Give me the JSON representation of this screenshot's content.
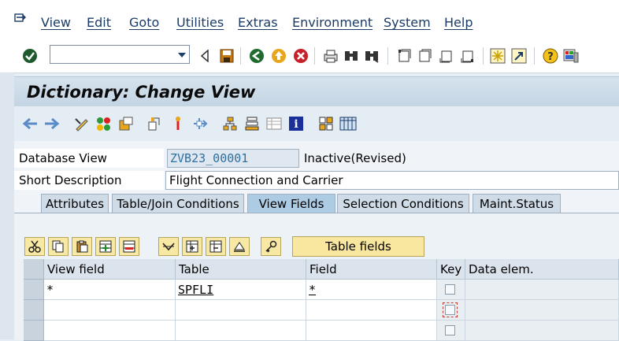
{
  "menu": {
    "items": [
      {
        "label": "View"
      },
      {
        "label": "Edit"
      },
      {
        "label": "Goto"
      },
      {
        "label": "Utilities"
      },
      {
        "label": "Extras"
      },
      {
        "label": "Environment"
      },
      {
        "label": "System"
      },
      {
        "label": "Help"
      }
    ]
  },
  "toolbar": {
    "command_value": ""
  },
  "title": "Dictionary: Change View",
  "header": {
    "db_view_label": "Database View",
    "db_view_value": "ZVB23_00001",
    "db_view_status": "Inactive(Revised)",
    "short_desc_label": "Short Description",
    "short_desc_value": "Flight Connection and Carrier"
  },
  "tabs": [
    {
      "label": "Attributes"
    },
    {
      "label": "Table/Join Conditions"
    },
    {
      "label": "View Fields",
      "active": true
    },
    {
      "label": "Selection Conditions"
    },
    {
      "label": "Maint.Status"
    }
  ],
  "table_toolbar": {
    "table_fields_label": "Table fields"
  },
  "grid": {
    "columns": [
      "View field",
      "Table",
      "Field",
      "Key",
      "Data elem."
    ],
    "rows": [
      {
        "view_field": "*",
        "table": "SPFLI",
        "field": "*",
        "key": false
      },
      {
        "view_field": "",
        "table": "",
        "field": "",
        "key": false
      },
      {
        "view_field": "",
        "table": "",
        "field": "",
        "key": false
      }
    ]
  },
  "colors": {
    "title_bg": "#c3d4e3",
    "active_tab": "#aecbe4",
    "button_yellow": "#f9e7a0"
  }
}
